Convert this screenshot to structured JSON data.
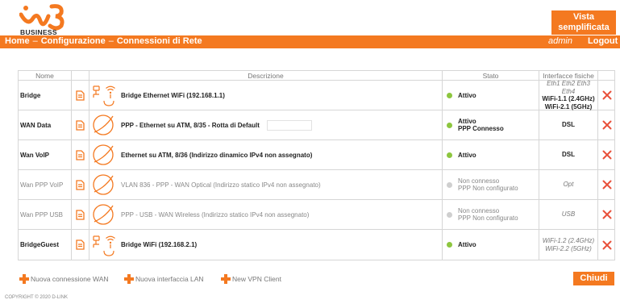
{
  "header": {
    "logo_text": "BUSINESS",
    "vista_label_line1": "Vista",
    "vista_label_line2": "semplificata"
  },
  "nav": {
    "home": "Home",
    "sep": "–",
    "configurazione": "Configurazione",
    "connessioni": "Connessioni di Rete",
    "user": "admin",
    "logout": "Logout"
  },
  "table": {
    "headers": {
      "nome": "Nome",
      "descrizione": "Descrizione",
      "stato": "Stato",
      "interfacce": "Interfacce fisiche"
    },
    "rows": [
      {
        "name": "Bridge",
        "icon": "bridge-wifi-icon",
        "desc": "Bridge Ethernet WiFi (192.168.1.1)",
        "state": "Attivo",
        "state2": "",
        "phys1": "Eth1 Eth2 Eth3 Eth4",
        "phys2": "WiFi-1.1 (2.4GHz)",
        "phys3": "WiFi-2.1 (5GHz)"
      },
      {
        "name": "WAN Data",
        "icon": "globe-icon",
        "desc": "PPP - Ethernet su ATM, 8/35 - Rotta di Default",
        "state": "Attivo",
        "state2": "PPP Connesso",
        "phys1": "DSL"
      },
      {
        "name": "Wan VoIP",
        "icon": "globe-icon",
        "desc": "Ethernet su ATM, 8/36 (Indirizzo dinamico IPv4 non assegnato)",
        "state": "Attivo",
        "state2": "",
        "phys1": "DSL"
      },
      {
        "name": "Wan PPP VoIP",
        "icon": "globe-icon",
        "desc": "VLAN 836 - PPP - WAN Optical (Indirizzo statico IPv4 non assegnato)",
        "state": "Non connesso",
        "state2": "PPP Non configurato",
        "phys1": "Opt"
      },
      {
        "name": "Wan PPP USB",
        "icon": "globe-icon",
        "desc": "PPP - USB - WAN Wireless (Indirizzo statico IPv4 non assegnato)",
        "state": "Non connesso",
        "state2": "PPP Non configurato",
        "phys1": "USB"
      },
      {
        "name": "BridgeGuest",
        "icon": "bridge-wifi-icon",
        "desc": "Bridge WiFi (192.168.2.1)",
        "state": "Attivo",
        "state2": "",
        "phys1": "WiFi-1.2 (2.4GHz)",
        "phys2": "WiFi-2.2 (5GHz)"
      }
    ]
  },
  "actions": {
    "nuova_wan": "Nuova connessione WAN",
    "nuova_lan": "Nuova interfaccia LAN",
    "new_vpn": "New VPN Client",
    "chiudi": "Chiudi"
  },
  "copyright": "COPYRIGHT © 2020 D-LINK",
  "colors": {
    "accent": "#f47920",
    "active_dot": "#8dc63f",
    "inactive_dot": "#cfcfcf",
    "delete": "#e8503a"
  }
}
